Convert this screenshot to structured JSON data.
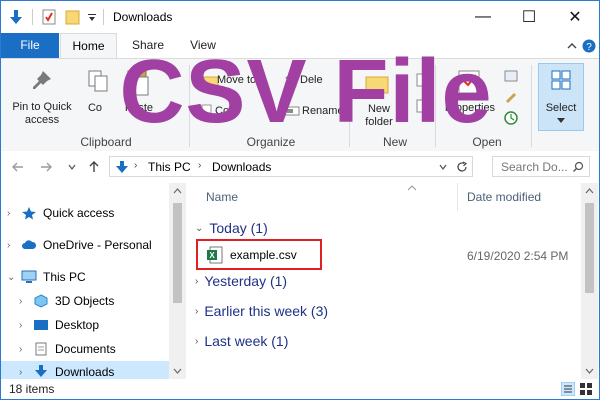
{
  "window": {
    "title": "Downloads",
    "minimize_glyph": "—",
    "maximize_glyph": "☐",
    "close_glyph": "✕"
  },
  "ribbon_tabs": [
    "File",
    "Home",
    "Share",
    "View"
  ],
  "ribbon": {
    "pin_label": "Pin to Quick access",
    "copy_label": "Co",
    "paste_label": "Paste",
    "copy_path_label": "Copy",
    "move_to_label": "Move to",
    "delete_label": "Dele",
    "rename_label": "Rename",
    "new_folder_label": "New folder",
    "properties_label": "Properties",
    "select_label": "Select",
    "groups": {
      "clipboard": "Clipboard",
      "organize": "Organize",
      "new": "New",
      "open": "Open"
    }
  },
  "overlay_title": "CSV File",
  "address": {
    "segments": [
      "This PC",
      "Downloads"
    ],
    "search_placeholder": "Search Do..."
  },
  "nav_pane": {
    "items": [
      {
        "label": "Quick access",
        "icon": "star-icon"
      },
      {
        "label": "OneDrive - Personal",
        "icon": "cloud-icon"
      },
      {
        "label": "This PC",
        "icon": "computer-icon"
      },
      {
        "label": "3D Objects",
        "icon": "cube-icon"
      },
      {
        "label": "Desktop",
        "icon": "desktop-icon"
      },
      {
        "label": "Documents",
        "icon": "document-icon"
      },
      {
        "label": "Downloads",
        "icon": "download-icon"
      }
    ]
  },
  "content": {
    "columns": [
      "Name",
      "Date modified"
    ],
    "groups": [
      {
        "label": "Today (1)"
      },
      {
        "label": "Yesterday (1)"
      },
      {
        "label": "Earlier this week (3)"
      },
      {
        "label": "Last week (1)"
      }
    ],
    "file": {
      "name": "example.csv",
      "date": "6/19/2020 2:54 PM",
      "icon": "excel-csv-icon"
    }
  },
  "status": {
    "items_text": "18 items"
  },
  "colors": {
    "accent": "#1a6fc4",
    "overlay": "#a13fa3",
    "highlight_border": "#e02020",
    "group_text": "#1e3287"
  }
}
